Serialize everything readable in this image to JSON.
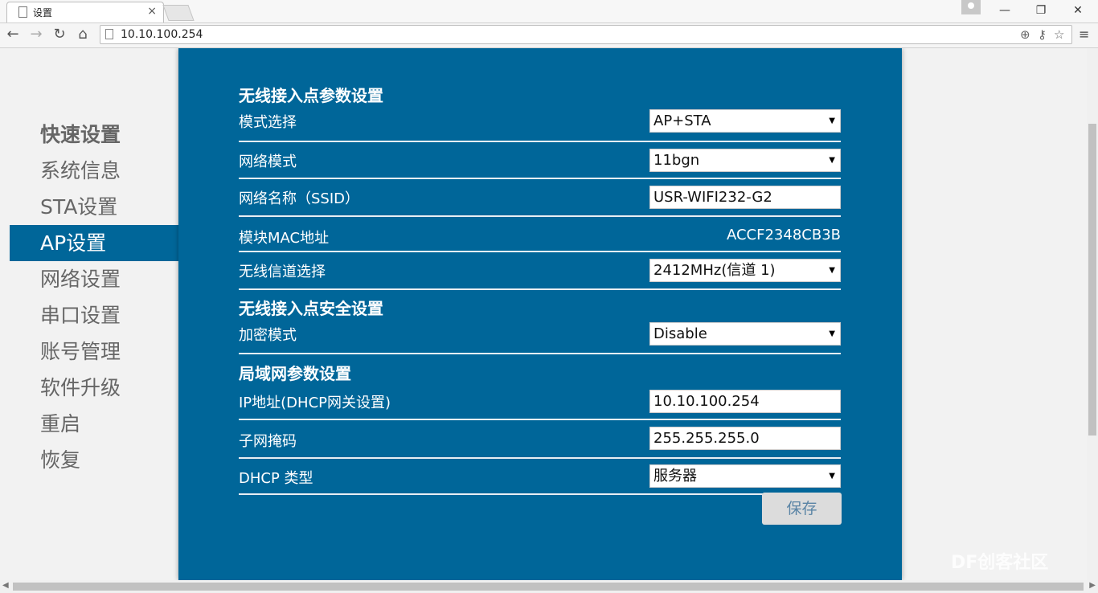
{
  "browser": {
    "tab_title": "设置",
    "tab_close": "×",
    "url": "10.10.100.254",
    "win_min": "—",
    "win_restore": "❐",
    "win_close": "✕",
    "nav_back": "←",
    "nav_forward": "→",
    "nav_reload": "↻",
    "nav_home": "⌂",
    "zoom_icon": "⊕",
    "key_icon": "⚷",
    "star_icon": "☆",
    "menu_icon": "≡"
  },
  "sidebar": {
    "items": [
      {
        "label": "快速设置"
      },
      {
        "label": "系统信息"
      },
      {
        "label": "STA设置"
      },
      {
        "label": "AP设置"
      },
      {
        "label": "网络设置"
      },
      {
        "label": "串口设置"
      },
      {
        "label": "账号管理"
      },
      {
        "label": "软件升级"
      },
      {
        "label": "重启"
      },
      {
        "label": "恢复"
      }
    ]
  },
  "ap": {
    "section1": "无线接入点参数设置",
    "mode_label": "模式选择",
    "mode_value": "AP+STA",
    "netmode_label": "网络模式",
    "netmode_value": "11bgn",
    "ssid_label": "网络名称（SSID）",
    "ssid_value": "USR-WIFI232-G2",
    "mac_label": "模块MAC地址",
    "mac_value": "ACCF2348CB3B",
    "channel_label": "无线信道选择",
    "channel_value": "2412MHz(信道 1)",
    "section2": "无线接入点安全设置",
    "enc_label": "加密模式",
    "enc_value": "Disable",
    "section3": "局域网参数设置",
    "ip_label": "IP地址(DHCP网关设置)",
    "ip_value": "10.10.100.254",
    "mask_label": "子网掩码",
    "mask_value": "255.255.255.0",
    "dhcp_label": "DHCP 类型",
    "dhcp_value": "服务器",
    "save_label": "保存",
    "select_arrow": "▼"
  },
  "watermark": "DF创客社区"
}
